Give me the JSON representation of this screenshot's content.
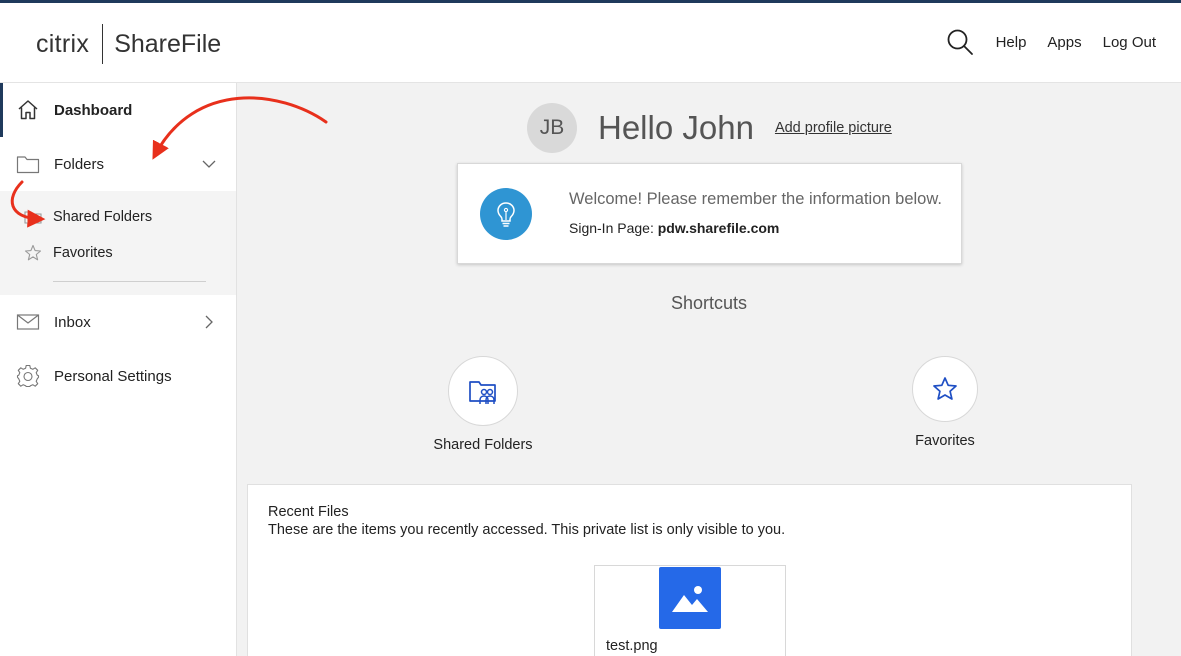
{
  "header": {
    "logo_citrix": "citrix",
    "logo_product": "ShareFile",
    "search_icon": "search-icon",
    "links": [
      "Help",
      "Apps",
      "Log Out"
    ]
  },
  "sidebar": {
    "items": [
      {
        "label": "Dashboard",
        "icon": "home-icon",
        "active": true
      },
      {
        "label": "Folders",
        "icon": "folder-icon",
        "expanded": true
      },
      {
        "label": "Inbox",
        "icon": "mail-icon"
      },
      {
        "label": "Personal Settings",
        "icon": "gear-icon"
      }
    ],
    "folders_sub": [
      {
        "label": "Shared Folders",
        "icon": "shared-folder-icon"
      },
      {
        "label": "Favorites",
        "icon": "star-icon"
      }
    ]
  },
  "profile": {
    "initials": "JB",
    "greeting": "Hello John",
    "add_picture": "Add profile picture"
  },
  "welcome": {
    "message": "Welcome! Please remember the information below.",
    "signin_label": "Sign-In Page:",
    "signin_value": "pdw.sharefile.com",
    "icon": "lightbulb-icon"
  },
  "shortcuts": {
    "title": "Shortcuts",
    "items": [
      {
        "label": "Shared Folders",
        "icon": "shared-folder-icon"
      },
      {
        "label": "Favorites",
        "icon": "star-icon"
      }
    ]
  },
  "recent": {
    "title": "Recent Files",
    "description": "These are the items you recently accessed. This private list is only visible to you.",
    "files": [
      {
        "name": "test.png",
        "icon": "image-icon"
      }
    ]
  },
  "colors": {
    "header_border": "#1f3a5c",
    "bulb_bg": "#2f95d3",
    "file_thumb": "#2569e8",
    "icon_blue": "#1f4fc4",
    "annotation_arrow": "#e8301c"
  }
}
